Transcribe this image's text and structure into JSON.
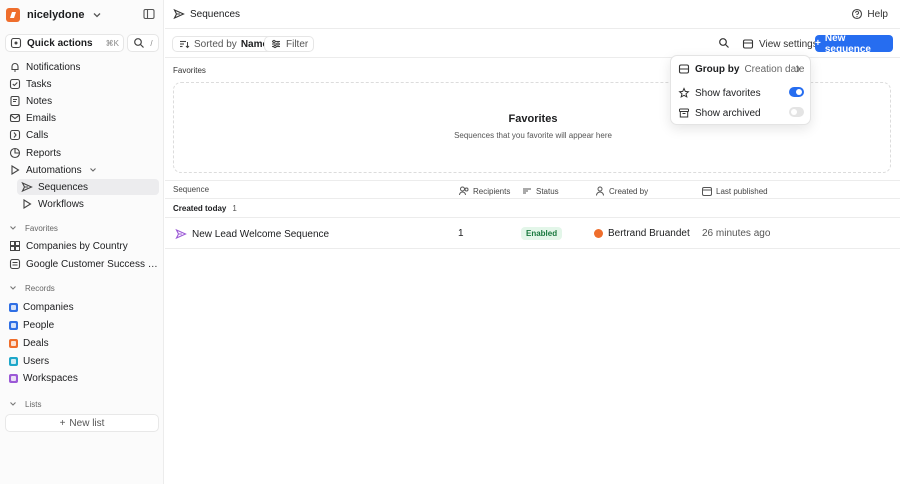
{
  "workspace": {
    "name": "nicelydone"
  },
  "quick_actions": {
    "label": "Quick actions",
    "shortcut": "⌘K",
    "slash": "/"
  },
  "nav": [
    {
      "label": "Notifications",
      "icon": "bell-icon"
    },
    {
      "label": "Tasks",
      "icon": "check-square-icon"
    },
    {
      "label": "Notes",
      "icon": "note-icon"
    },
    {
      "label": "Emails",
      "icon": "mail-icon"
    },
    {
      "label": "Calls",
      "icon": "phone-icon"
    },
    {
      "label": "Reports",
      "icon": "chart-icon"
    },
    {
      "label": "Automations",
      "icon": "automation-icon"
    }
  ],
  "automations_sub": [
    {
      "label": "Sequences",
      "icon": "send-icon",
      "active": true
    },
    {
      "label": "Workflows",
      "icon": "play-icon",
      "active": false
    }
  ],
  "favorites_section": {
    "label": "Favorites"
  },
  "favorites": [
    {
      "label": "Companies by Country"
    },
    {
      "label": "Google Customer Success & Part…"
    }
  ],
  "records_section": {
    "label": "Records"
  },
  "records": [
    {
      "label": "Companies",
      "color": "#2f6fe4"
    },
    {
      "label": "People",
      "color": "#2f6fe4"
    },
    {
      "label": "Deals",
      "color": "#ef6e2c"
    },
    {
      "label": "Users",
      "color": "#1ea7c9"
    },
    {
      "label": "Workspaces",
      "color": "#9b59d6"
    }
  ],
  "lists_section": {
    "label": "Lists"
  },
  "new_list": {
    "label": "New list"
  },
  "header": {
    "title": "Sequences",
    "help": "Help"
  },
  "toolbar": {
    "sorted_prefix": "Sorted by",
    "sorted_value": "Name",
    "filter": "Filter",
    "view_settings": "View settings",
    "new_sequence": "New sequence"
  },
  "favorites_panel": {
    "section_label": "Favorites",
    "title": "Favorites",
    "subtitle": "Sequences that you favorite will appear here"
  },
  "table": {
    "columns": [
      "Sequence",
      "Recipients",
      "Status",
      "Created by",
      "Last published"
    ],
    "group": {
      "label": "Created today",
      "count": "1"
    },
    "rows": [
      {
        "sequence": "New Lead Welcome Sequence",
        "recipients": "1",
        "status": "Enabled",
        "created_by": "Bertrand Bruandet",
        "last_published": "26 minutes ago"
      }
    ]
  },
  "view_menu": {
    "group_by_label": "Group by",
    "group_by_value": "Creation date",
    "show_favorites": "Show favorites",
    "show_favorites_on": true,
    "show_archived": "Show archived",
    "show_archived_on": false
  },
  "colors": {
    "accent": "#266df0",
    "brand": "#ef6e2c",
    "status_enabled": "#18783d"
  }
}
